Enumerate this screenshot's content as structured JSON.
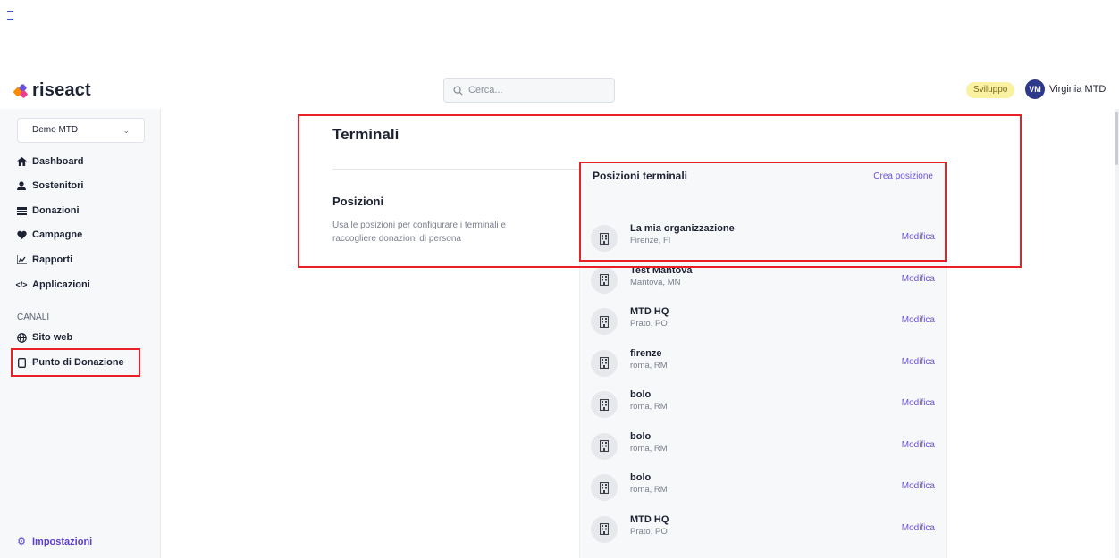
{
  "app": {
    "brand": "riseact",
    "search_placeholder": "Cerca...",
    "env_badge": "Sviluppo",
    "user": {
      "initials": "VM",
      "name": "Virginia MTD"
    }
  },
  "sidebar": {
    "org": "Demo MTD",
    "items": [
      {
        "label": "Dashboard",
        "icon": "home-icon"
      },
      {
        "label": "Sostenitori",
        "icon": "user-icon"
      },
      {
        "label": "Donazioni",
        "icon": "money-icon"
      },
      {
        "label": "Campagne",
        "icon": "heart-icon"
      },
      {
        "label": "Rapporti",
        "icon": "chart-icon"
      },
      {
        "label": "Applicazioni",
        "icon": "code-icon"
      }
    ],
    "channels_label": "CANALI",
    "channels": [
      {
        "label": "Sito web",
        "icon": "globe-icon"
      },
      {
        "label": "Punto di Donazione",
        "icon": "tablet-icon"
      }
    ],
    "settings": {
      "label": "Impostazioni",
      "icon": "gear-icon"
    }
  },
  "page": {
    "title": "Terminali",
    "section_title": "Posizioni",
    "section_desc": "Usa le posizioni per configurare i terminali e raccogliere donazioni di persona"
  },
  "panel": {
    "title": "Posizioni terminali",
    "create_label": "Crea posizione",
    "edit_label": "Modifica",
    "locations": [
      {
        "name": "La mia organizzazione",
        "city": "Firenze, FI"
      },
      {
        "name": "Test Mantova",
        "city": "Mantova, MN"
      },
      {
        "name": "MTD HQ",
        "city": "Prato, PO"
      },
      {
        "name": "firenze",
        "city": "roma, RM"
      },
      {
        "name": "bolo",
        "city": "roma, RM"
      },
      {
        "name": "bolo",
        "city": "roma, RM"
      },
      {
        "name": "bolo",
        "city": "roma, RM"
      },
      {
        "name": "MTD HQ",
        "city": "Prato, PO"
      }
    ]
  },
  "colors": {
    "accent": "#6b52d6",
    "highlight": "#ea2027",
    "avatar": "#2d3a8c",
    "badge": "#fbf1a3"
  }
}
